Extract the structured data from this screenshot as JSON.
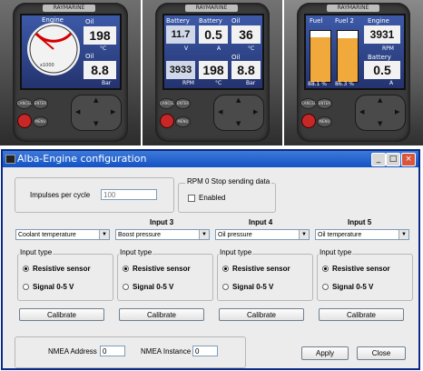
{
  "photos": {
    "brand": "RAYMARINE",
    "display1": {
      "gauge_label": "Engine",
      "gauge_scale": "x1000",
      "oil_temp_label": "Oil",
      "oil_temp_value": "198",
      "oil_temp_unit": "°C",
      "oil_press_label": "Oil",
      "oil_press_value": "8.8",
      "oil_press_unit": "Bar"
    },
    "display2": {
      "battery1_label": "Battery",
      "battery1_value": "11.7",
      "battery1_unit": "V",
      "battery2_label": "Battery",
      "battery2_value": "0.5",
      "battery2_unit": "A",
      "oil1_label": "Oil",
      "oil1_value": "36",
      "oil1_unit": "°C",
      "rpm_value": "3933",
      "rpm_unit": "RPM",
      "oil2_value": "198",
      "oil2_unit": "°C",
      "oil3_label": "Oil",
      "oil3_value": "8.8",
      "oil3_unit": "Bar"
    },
    "display3": {
      "fuel1_label": "Fuel",
      "fuel2_label": "Fuel 2",
      "engine_label": "Engine",
      "engine_value": "3931",
      "engine_unit": "RPM",
      "battery_label": "Battery",
      "battery_value": "0.5",
      "battery_unit": "A",
      "fuel1_pct": "88.1 %",
      "fuel2_pct": "86.3 %",
      "fuel1_level": 0.88,
      "fuel2_level": 0.86
    },
    "keys": {
      "cancel": "CANCEL",
      "enter": "ENTER",
      "menu": "MENU"
    }
  },
  "window": {
    "title": "Alba-Engine configuration",
    "impulses_label": "Impulses per cycle",
    "impulses_value": "100",
    "rpm_group_label": "RPM 0 Stop sending data",
    "enabled_label": "Enabled",
    "inputs": [
      {
        "header": "",
        "select": "Coolant temperature",
        "type_label": "Input type",
        "opt1": "Resistive sensor",
        "opt2": "Signal 0-5 V",
        "calibrate": "Calibrate"
      },
      {
        "header": "Input 3",
        "select": "Boost pressure",
        "type_label": "Input type",
        "opt1": "Resistive sensor",
        "opt2": "Signal 0-5 V",
        "calibrate": "Calibrate"
      },
      {
        "header": "Input 4",
        "select": "Oil pressure",
        "type_label": "Input type",
        "opt1": "Resistive sensor",
        "opt2": "Signal 0-5 V",
        "calibrate": "Calibrate"
      },
      {
        "header": "Input  5",
        "select": "Oil temperature",
        "type_label": "Input type",
        "opt1": "Resistive sensor",
        "opt2": "Signal 0-5 V",
        "calibrate": "Calibrate"
      }
    ],
    "nmea_address_label": "NMEA Address",
    "nmea_address_value": "0",
    "nmea_instance_label": "NMEA Instance",
    "nmea_instance_value": "0",
    "apply_label": "Apply",
    "close_label": "Close",
    "titlebar_buttons": {
      "min": "_",
      "max": "□",
      "close": "×"
    }
  }
}
